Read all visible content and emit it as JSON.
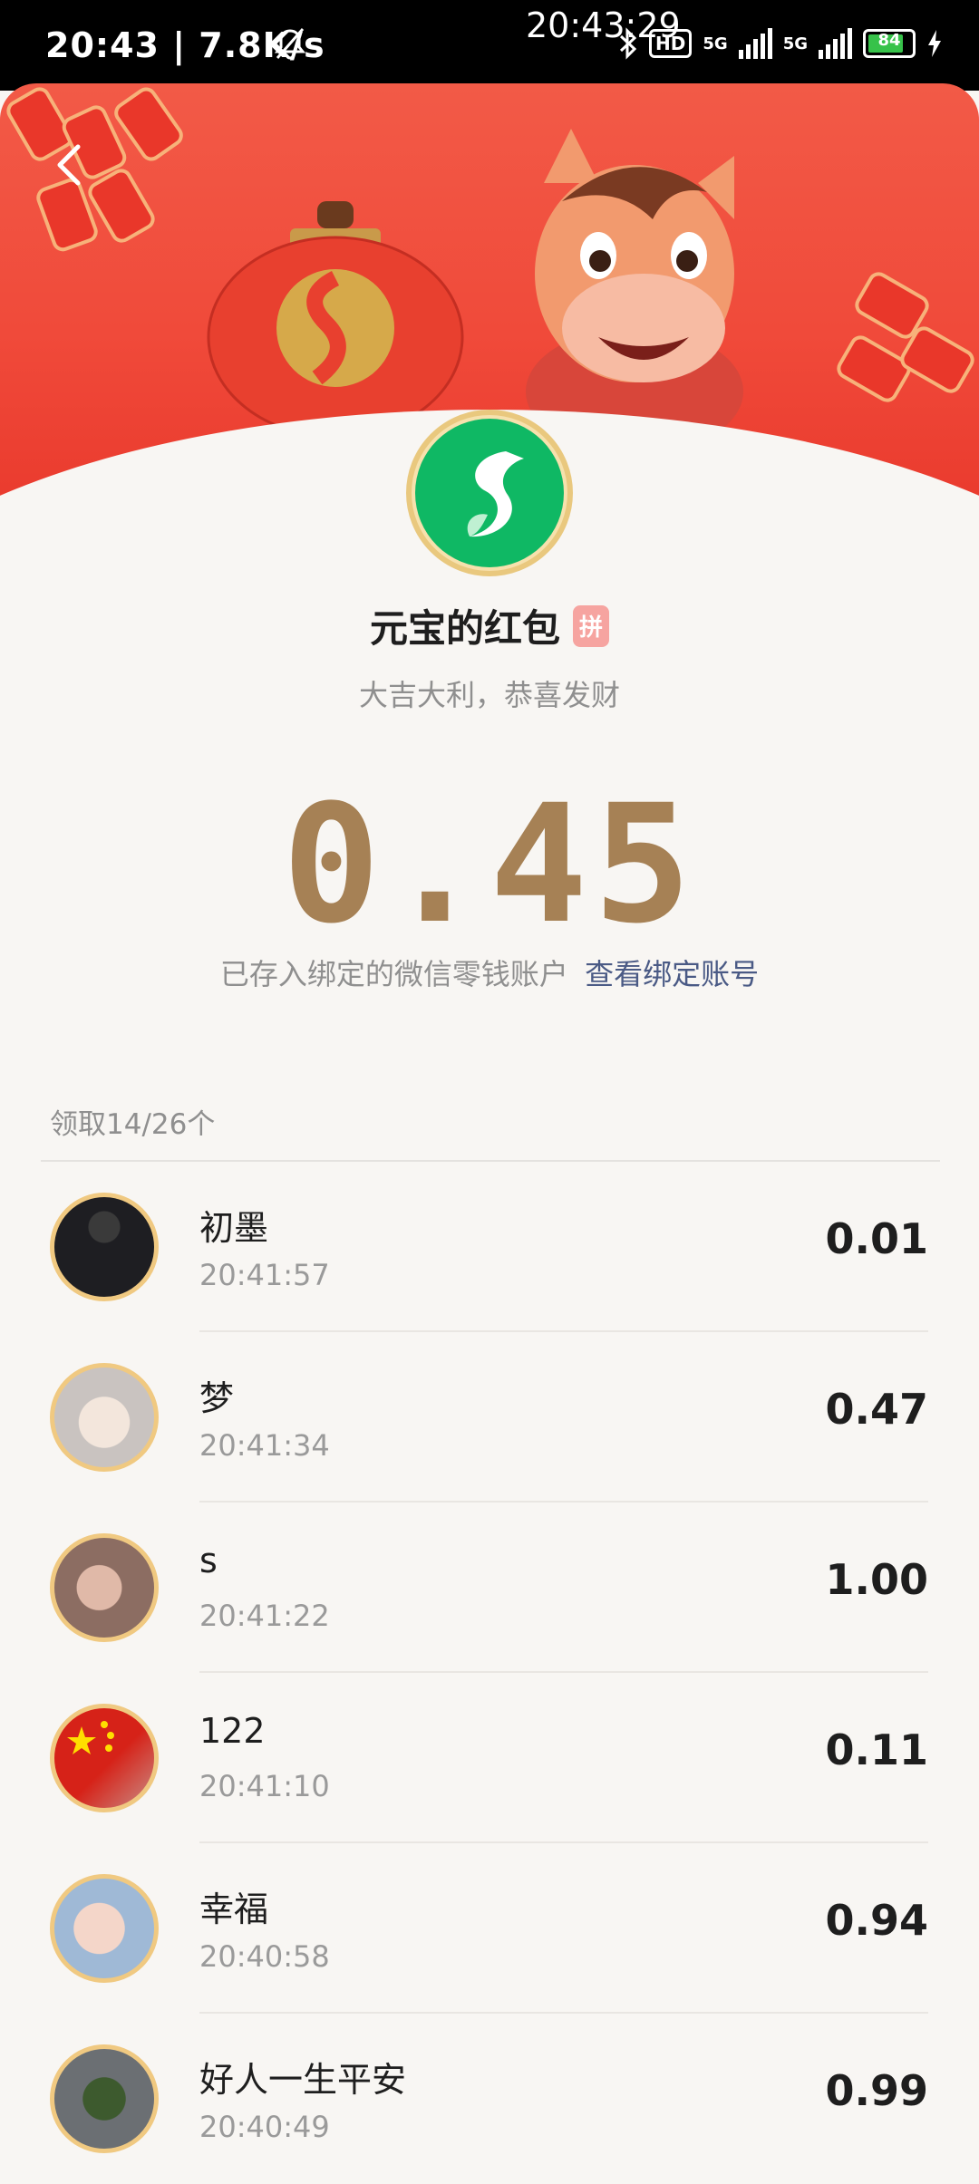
{
  "status_bar": {
    "left_text": "20:43 | 7.8K/s",
    "center_time": "20:43:29",
    "hd": "HD",
    "net1": "5G",
    "net2": "5G",
    "battery": "84"
  },
  "packet": {
    "title": "元宝的红包",
    "badge": "拼",
    "subtitle": "大吉大利，恭喜发财",
    "amount": "0.45",
    "deposit_text": "已存入绑定的微信零钱账户",
    "deposit_link": "查看绑定账号"
  },
  "claims": {
    "summary": "领取14/26个",
    "items": [
      {
        "name": "初墨",
        "time": "20:41:57",
        "amount": "0.01"
      },
      {
        "name": "梦",
        "time": "20:41:34",
        "amount": "0.47"
      },
      {
        "name": "s",
        "time": "20:41:22",
        "amount": "1.00"
      },
      {
        "name": "122",
        "time": "20:41:10",
        "amount": "0.11"
      },
      {
        "name": "幸福",
        "time": "20:40:58",
        "amount": "0.94"
      },
      {
        "name": "好人一生平安",
        "time": "20:40:49",
        "amount": "0.99"
      }
    ]
  },
  "colors": {
    "banner_red": "#f04a3a",
    "amount_gold": "#a68155",
    "link_blue": "#4a5a85",
    "brand_green": "#0fb864"
  }
}
